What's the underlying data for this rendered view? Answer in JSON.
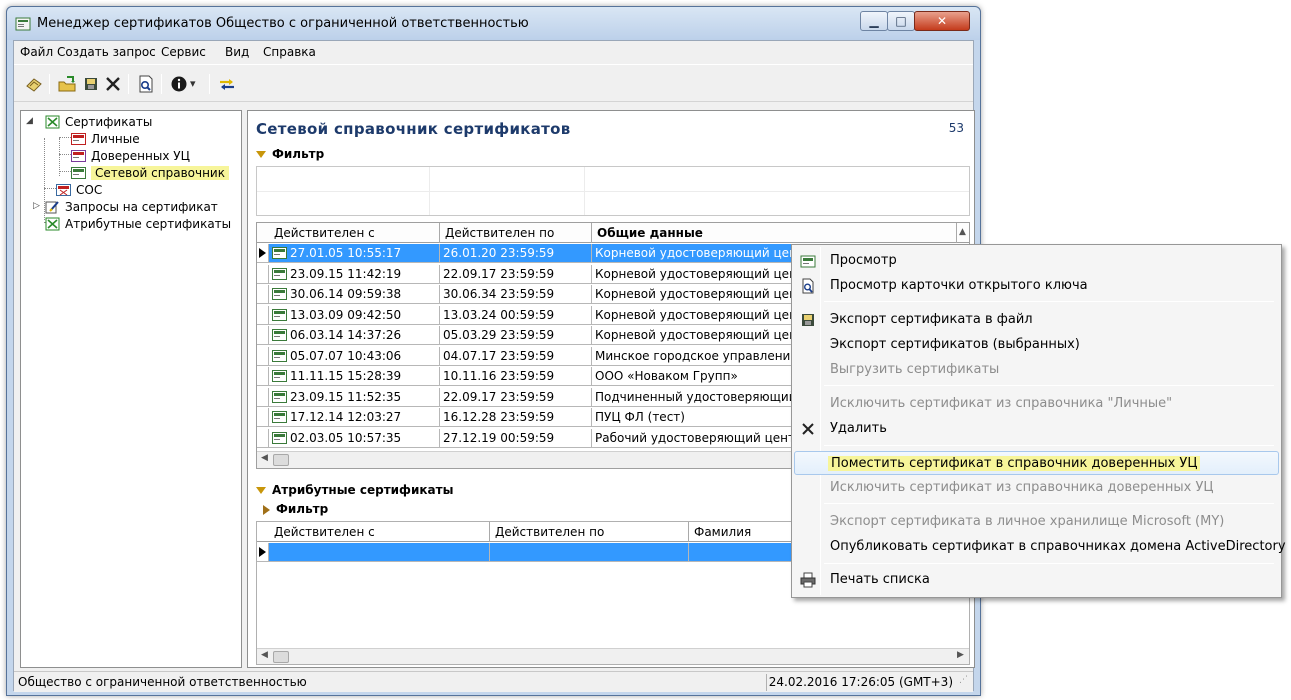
{
  "window": {
    "title": "Менеджер сертификатов  Общество с ограниченной ответственностью"
  },
  "menubar": {
    "items": [
      "Файл",
      "Создать запрос",
      "Сервис",
      "Вид",
      "Справка"
    ]
  },
  "toolbar": {
    "info_dropdown": "▾"
  },
  "tree": {
    "root": "Сертификаты",
    "children": [
      "Личные",
      "Доверенных УЦ",
      "Сетевой справочник"
    ],
    "items": [
      "СОС",
      "Запросы на сертификат",
      "Атрибутные сертификаты"
    ]
  },
  "main": {
    "title": "Сетевой справочник сертификатов",
    "count": "53",
    "filter_label": "Фильтр",
    "columns": [
      "Действителен с",
      "Действителен по",
      "Общие данные"
    ],
    "rows": [
      {
        "from": "27.01.05 10:55:17",
        "to": "26.01.20 23:59:59",
        "info": "Корневой удостоверяющий центр"
      },
      {
        "from": "23.09.15 11:42:19",
        "to": "22.09.17 23:59:59",
        "info": "Корневой удостоверяющий центр"
      },
      {
        "from": "30.06.14 09:59:38",
        "to": "30.06.34 23:59:59",
        "info": "Корневой удостоверяющий центр Го"
      },
      {
        "from": "13.03.09 09:42:50",
        "to": "13.03.24 00:59:59",
        "info": "Корневой удостоверяющий центр Р"
      },
      {
        "from": "06.03.14 14:37:26",
        "to": "05.03.29 23:59:59",
        "info": "Корневой удостоверяющий центр с."
      },
      {
        "from": "05.07.07 10:43:06",
        "to": "04.07.17 23:59:59",
        "info": "Минское городское управление удс"
      },
      {
        "from": "11.11.15 15:28:39",
        "to": "10.11.16 23:59:59",
        "info": "ООО «Новаком Групп»"
      },
      {
        "from": "23.09.15 11:52:35",
        "to": "22.09.17 23:59:59",
        "info": "Подчиненный удостоверяющий цент"
      },
      {
        "from": "17.12.14 12:03:27",
        "to": "16.12.28 23:59:59",
        "info": "ПУЦ ФЛ (тест)"
      },
      {
        "from": "02.03.05 10:57:35",
        "to": "27.12.19 00:59:59",
        "info": "Рабочий удостоверяющий центр ЭС"
      }
    ]
  },
  "attr": {
    "title": "Атрибутные сертификаты",
    "filter_label": "Фильтр",
    "columns": [
      "Действителен с",
      "Действителен по",
      "Фамилия"
    ]
  },
  "status": {
    "left": "Общество с ограниченной ответственностью",
    "right": "24.02.2016 17:26:05 (GMT+3)"
  },
  "context_menu": {
    "items": [
      "Просмотр",
      "Просмотр карточки открытого ключа",
      "Экспорт сертификата в файл",
      "Экспорт сертификатов (выбранных)",
      "Выгрузить сертификаты",
      "Исключить сертификат из справочника \"Личные\"",
      "Удалить",
      "Поместить сертификат в справочник доверенных УЦ",
      "Исключить сертификат из справочника доверенных УЦ",
      "Экспорт сертификата в личное хранилище Microsoft (MY)",
      "Опубликовать сертификат в справочниках домена ActiveDirectory",
      "Печать списка"
    ]
  },
  "colors": {
    "accent": "#3399ff",
    "highlight": "#f7f59a",
    "title": "#1d3a6b"
  }
}
